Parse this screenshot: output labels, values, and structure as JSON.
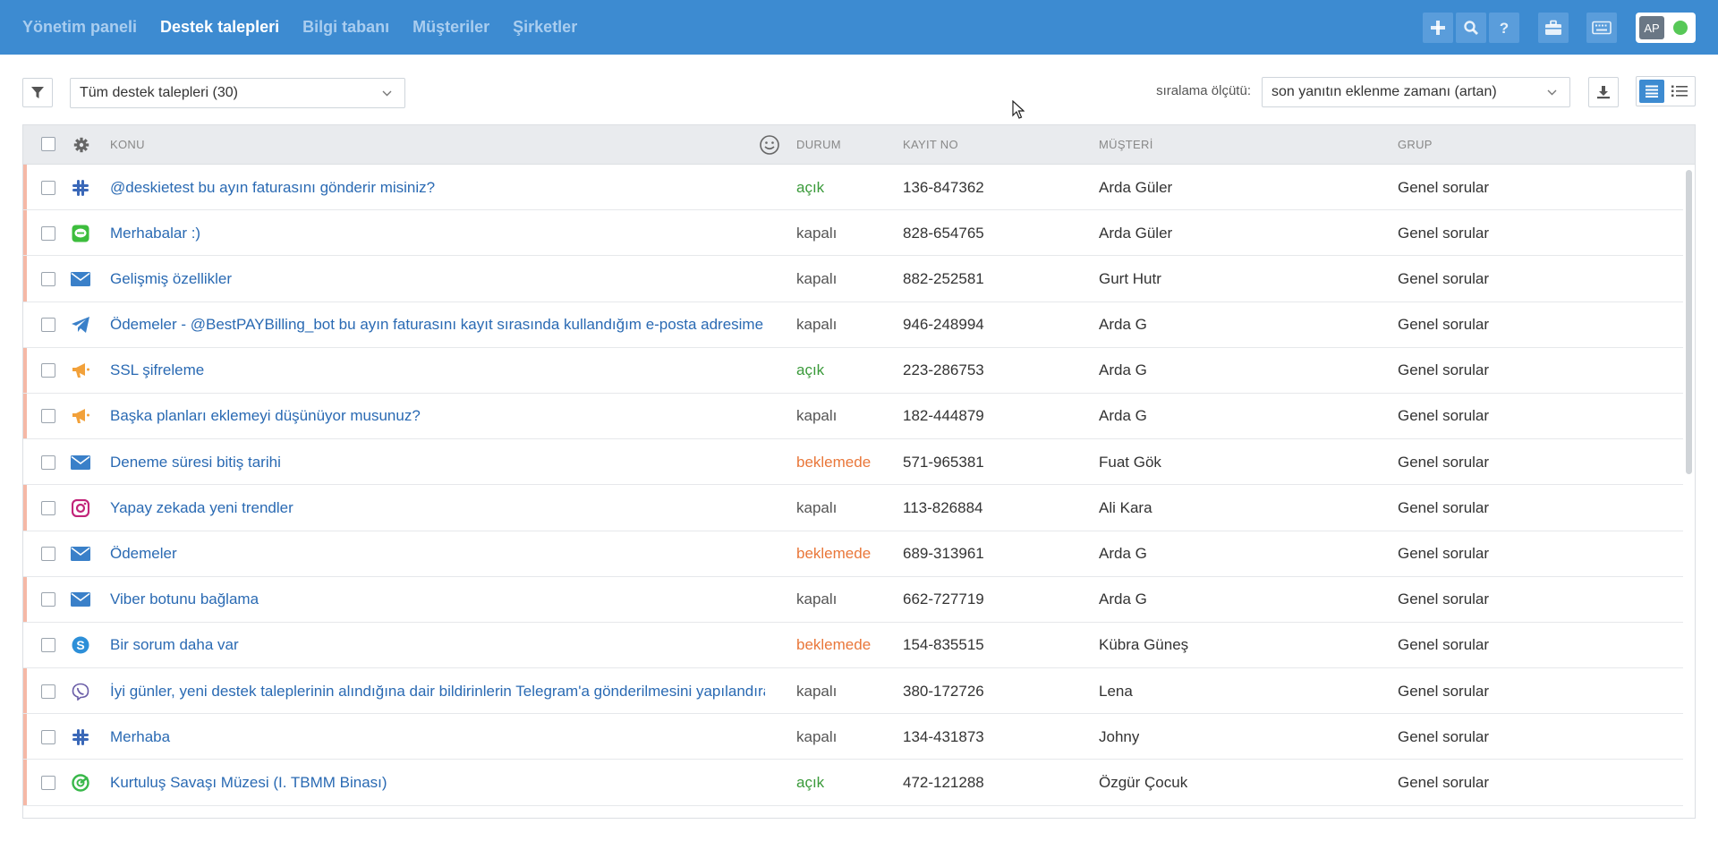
{
  "nav": {
    "items": [
      {
        "label": "Yönetim paneli",
        "active": false
      },
      {
        "label": "Destek talepleri",
        "active": true
      },
      {
        "label": "Bilgi tabanı",
        "active": false
      },
      {
        "label": "Müşteriler",
        "active": false
      },
      {
        "label": "Şirketler",
        "active": false
      }
    ]
  },
  "topbar_icons": [
    "plus-icon",
    "search-icon",
    "help-icon",
    "briefcase-icon",
    "keyboard-icon"
  ],
  "user": {
    "initials": "AP",
    "status_color": "#57c857"
  },
  "filter": {
    "selected": "Tüm destek talepleri (30)"
  },
  "sort": {
    "label": "sıralama ölçütü:",
    "selected": "son yanıtın eklenme zamanı (artan)"
  },
  "columns": {
    "subject": "KONU",
    "status": "DURUM",
    "ticket_no": "KAYIT NO",
    "customer": "MÜŞTERİ",
    "group": "GRUP"
  },
  "colors": {
    "accent": "#3d8bd1",
    "open": "#3a9a3a",
    "pending": "#e9773a",
    "link": "#2a6ab3"
  },
  "tickets": [
    {
      "channel": "slack",
      "subject": "@deskietest bu ayın faturasını gönderir misiniz?",
      "status": "açık",
      "status_type": "open",
      "ticket_no": "136-847362",
      "customer": "Arda Güler",
      "group": "Genel sorular",
      "flag": true
    },
    {
      "channel": "line",
      "subject": "Merhabalar :)",
      "status": "kapalı",
      "status_type": "closed",
      "ticket_no": "828-654765",
      "customer": "Arda Güler",
      "group": "Genel sorular",
      "flag": true
    },
    {
      "channel": "email",
      "subject": "Gelişmiş özellikler",
      "status": "kapalı",
      "status_type": "closed",
      "ticket_no": "882-252581",
      "customer": "Gurt Hutr",
      "group": "Genel sorular",
      "flag": true
    },
    {
      "channel": "telegram",
      "subject": "Ödemeler - @BestPAYBilling_bot bu ayın faturasını kayıt sırasında kullandığım e-posta adresime gönderebilir misiniz?",
      "status": "kapalı",
      "status_type": "closed",
      "ticket_no": "946-248994",
      "customer": "Arda G",
      "group": "Genel sorular",
      "flag": false
    },
    {
      "channel": "megaphone",
      "subject": "SSL şifreleme",
      "status": "açık",
      "status_type": "open",
      "ticket_no": "223-286753",
      "customer": "Arda G",
      "group": "Genel sorular",
      "flag": true
    },
    {
      "channel": "megaphone",
      "subject": "Başka planları eklemeyi düşünüyor musunuz?",
      "status": "kapalı",
      "status_type": "closed",
      "ticket_no": "182-444879",
      "customer": "Arda G",
      "group": "Genel sorular",
      "flag": true
    },
    {
      "channel": "email",
      "subject": "Deneme süresi bitiş tarihi",
      "status": "beklemede",
      "status_type": "pending",
      "ticket_no": "571-965381",
      "customer": "Fuat Gök",
      "group": "Genel sorular",
      "flag": false
    },
    {
      "channel": "instagram",
      "subject": "Yapay zekada yeni trendler",
      "status": "kapalı",
      "status_type": "closed",
      "ticket_no": "113-826884",
      "customer": "Ali Kara",
      "group": "Genel sorular",
      "flag": true
    },
    {
      "channel": "email",
      "subject": "Ödemeler",
      "status": "beklemede",
      "status_type": "pending",
      "ticket_no": "689-313961",
      "customer": "Arda G",
      "group": "Genel sorular",
      "flag": false
    },
    {
      "channel": "email",
      "subject": "Viber botunu bağlama",
      "status": "kapalı",
      "status_type": "closed",
      "ticket_no": "662-727719",
      "customer": "Arda G",
      "group": "Genel sorular",
      "flag": true
    },
    {
      "channel": "skype",
      "subject": "Bir sorum daha var",
      "status": "beklemede",
      "status_type": "pending",
      "ticket_no": "154-835515",
      "customer": "Kübra Güneş",
      "group": "Genel sorular",
      "flag": false
    },
    {
      "channel": "viber",
      "subject": "İyi günler, yeni destek taleplerinin alındığına dair bildirinlerin Telegram'a gönderilmesini yapılandırabilir miyim?",
      "status": "kapalı",
      "status_type": "closed",
      "ticket_no": "380-172726",
      "customer": "Lena",
      "group": "Genel sorular",
      "flag": true
    },
    {
      "channel": "slack",
      "subject": "Merhaba",
      "status": "kapalı",
      "status_type": "closed",
      "ticket_no": "134-431873",
      "customer": "Johny",
      "group": "Genel sorular",
      "flag": true
    },
    {
      "channel": "widget",
      "subject": "Kurtuluş Savaşı Müzesi (I. TBMM Binası)",
      "status": "açık",
      "status_type": "open",
      "ticket_no": "472-121288",
      "customer": "Özgür Çocuk",
      "group": "Genel sorular",
      "flag": true
    }
  ]
}
